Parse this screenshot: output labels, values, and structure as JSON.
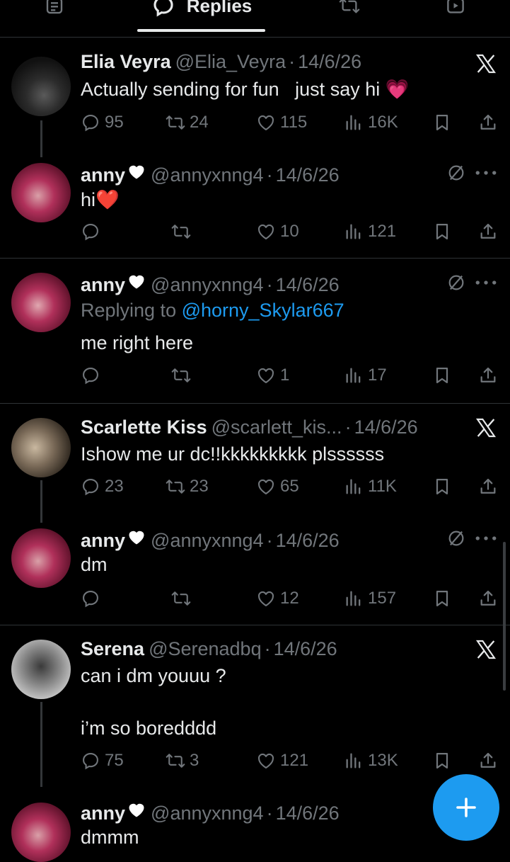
{
  "tabs": {
    "replies_label": "Replies"
  },
  "posts": [
    {
      "name": "Elia Veyra",
      "handle": "@Elia_Veyra",
      "date": "14/6/26",
      "text": "Actually sending for fun   just say hi",
      "emoji": "💗",
      "replies": "95",
      "reposts": "24",
      "likes": "115",
      "views": "16K"
    },
    {
      "name": "anny",
      "handle": "@annyxnng4",
      "date": "14/6/26",
      "text": "hi",
      "emoji": "❤️",
      "replies": "",
      "reposts": "",
      "likes": "10",
      "views": "121"
    },
    {
      "name": "anny",
      "handle": "@annyxnng4",
      "date": "14/6/26",
      "replying_prefix": "Replying to ",
      "replying_to": "@horny_Skylar667",
      "text": "me right here",
      "replies": "",
      "reposts": "",
      "likes": "1",
      "views": "17"
    },
    {
      "name": "Scarlette Kiss",
      "handle": "@scarlett_kis...",
      "date": "14/6/26",
      "text": "Ishow me ur dc!!kkkkkkkkk plssssss",
      "replies": "23",
      "reposts": "23",
      "likes": "65",
      "views": "11K"
    },
    {
      "name": "anny",
      "handle": "@annyxnng4",
      "date": "14/6/26",
      "text": "dm",
      "replies": "",
      "reposts": "",
      "likes": "12",
      "views": "157"
    },
    {
      "name": "Serena",
      "handle": "@Serenadbq",
      "date": "14/6/26",
      "text": "can i dm youuu ?",
      "text2": "i’m so boredddd",
      "replies": "75",
      "reposts": "3",
      "likes": "121",
      "views": "13K"
    },
    {
      "name": "anny",
      "handle": "@annyxnng4",
      "date": "14/6/26",
      "text": "dmmm"
    }
  ],
  "icons": {
    "accent": "#1d9bf0",
    "muted": "#71767b"
  }
}
